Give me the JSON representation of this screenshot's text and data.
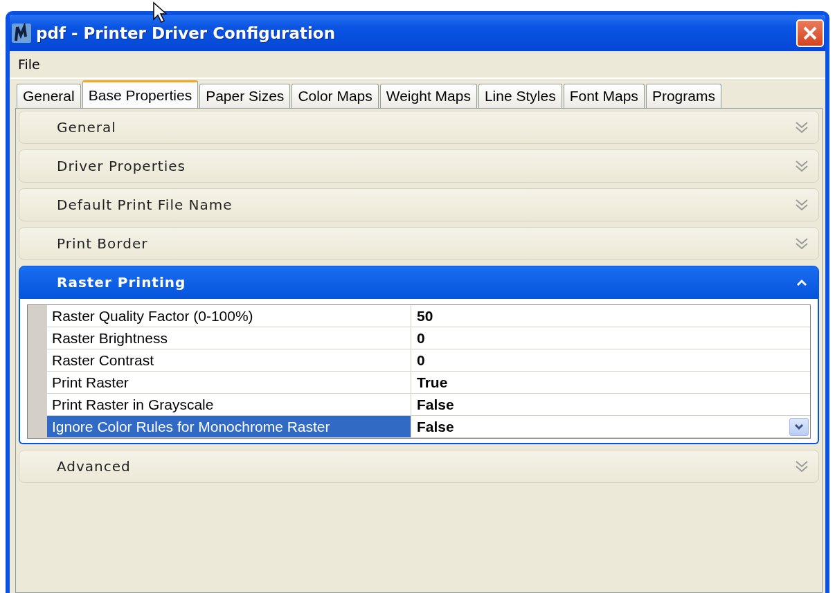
{
  "window": {
    "title": "pdf - Printer Driver Configuration"
  },
  "menu": [
    "File"
  ],
  "tabs": [
    {
      "label": "General",
      "selected": false
    },
    {
      "label": "Base Properties",
      "selected": true
    },
    {
      "label": "Paper Sizes",
      "selected": false
    },
    {
      "label": "Color Maps",
      "selected": false
    },
    {
      "label": "Weight Maps",
      "selected": false
    },
    {
      "label": "Line Styles",
      "selected": false
    },
    {
      "label": "Font Maps",
      "selected": false
    },
    {
      "label": "Programs",
      "selected": false
    }
  ],
  "sections": [
    {
      "title": "General",
      "expanded": false
    },
    {
      "title": "Driver Properties",
      "expanded": false
    },
    {
      "title": "Default Print File Name",
      "expanded": false
    },
    {
      "title": "Print Border",
      "expanded": false
    },
    {
      "title": "Raster Printing",
      "expanded": true,
      "properties": [
        {
          "name": "Raster Quality Factor (0-100%)",
          "value": "50",
          "selected": false
        },
        {
          "name": "Raster Brightness",
          "value": "0",
          "selected": false
        },
        {
          "name": "Raster Contrast",
          "value": "0",
          "selected": false
        },
        {
          "name": "Print Raster",
          "value": "True",
          "selected": false
        },
        {
          "name": "Print Raster in Grayscale",
          "value": "False",
          "selected": false
        },
        {
          "name": "Ignore Color Rules for Monochrome Raster",
          "value": "False",
          "selected": true
        }
      ]
    },
    {
      "title": "Advanced",
      "expanded": false
    }
  ]
}
